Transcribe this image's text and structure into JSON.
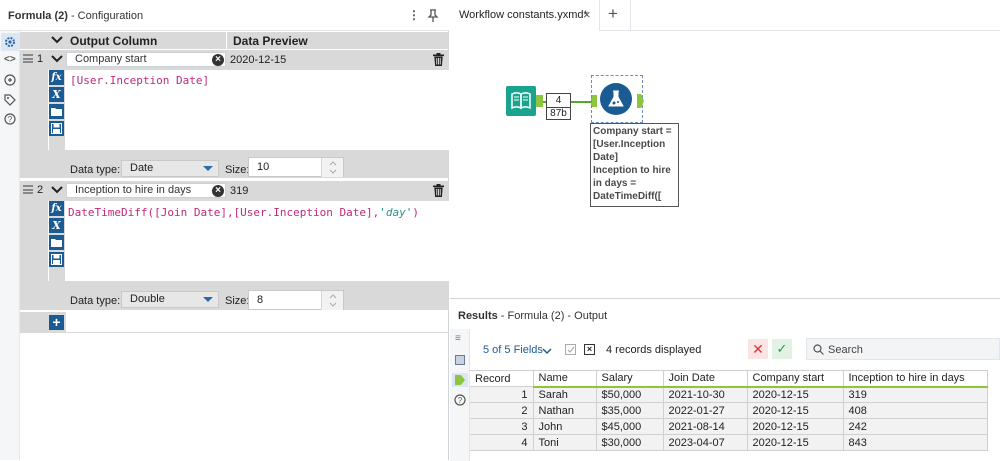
{
  "config_panel": {
    "title": "Formula (2)",
    "subtitle": " - Configuration",
    "menu_icon": "kebab-menu-icon",
    "pin_icon": "pin-icon",
    "columns": {
      "output": "Output Column",
      "preview": "Data Preview"
    },
    "rows": [
      {
        "num": "1",
        "output_column": "Company start",
        "preview": "2020-12-15",
        "expression": "[User.Inception Date]",
        "data_type_label": "Data type:",
        "data_type": "Date",
        "size_label": "Size:",
        "size": "10"
      },
      {
        "num": "2",
        "output_column": "Inception to hire in days",
        "preview": "319",
        "expression_fn": "DateTimeDiff(",
        "expression_args": "[Join Date],[User.Inception Date],",
        "expression_str": "'day'",
        "expression_end": ")",
        "data_type_label": "Data type:",
        "data_type": "Double",
        "size_label": "Size:",
        "size": "8"
      }
    ],
    "add_label": "+"
  },
  "tabs": [
    {
      "label": "Workflow constants.yxmd*",
      "close": "×"
    },
    {
      "label": "+"
    }
  ],
  "canvas": {
    "connection_count": "4",
    "connection_size": "87b",
    "annotation": [
      "Company start =",
      "[User.Inception",
      "Date]",
      "Inception to hire",
      "in days =",
      "DateTimeDiff(["
    ]
  },
  "results": {
    "title": "Results",
    "subtitle": " - Formula (2) - Output",
    "fields_label": "5 of 5 Fields",
    "records_label": "4 records displayed",
    "search_placeholder": "Search",
    "columns": [
      "Record",
      "Name",
      "Salary",
      "Join Date",
      "Company start",
      "Inception to hire in days"
    ],
    "rows": [
      [
        "1",
        "Sarah",
        "$50,000",
        "2021-10-30",
        "2020-12-15",
        "319"
      ],
      [
        "2",
        "Nathan",
        "$35,000",
        "2022-01-27",
        "2020-12-15",
        "408"
      ],
      [
        "3",
        "John",
        "$45,000",
        "2021-08-14",
        "2020-12-15",
        "242"
      ],
      [
        "4",
        "Toni",
        "$30,000",
        "2023-04-07",
        "2020-12-15",
        "843"
      ]
    ]
  },
  "colors": {
    "accent": "#1a5b93",
    "keyword": "#c0297c",
    "string": "#2c8f8a",
    "green": "#8cc63f"
  }
}
